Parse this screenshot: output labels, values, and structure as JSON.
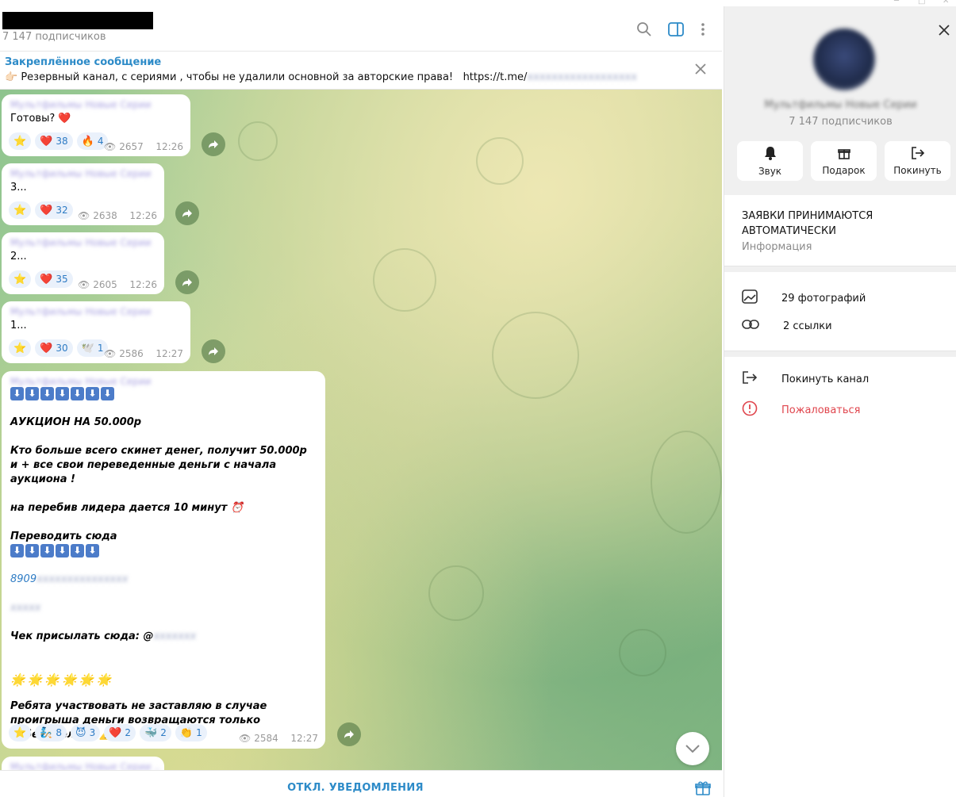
{
  "header": {
    "subscribers": "7 147 подписчиков"
  },
  "pinned": {
    "title": "Закреплённое сообщение",
    "emoji": "👉🏻",
    "text": "Резервный канал, с сериями , чтобы не удалили основной за авторские права!",
    "link": "https://t.me/"
  },
  "messages": [
    {
      "text": "Готовы? ❤️",
      "reactions": [
        {
          "emoji": "⭐",
          "count": ""
        },
        {
          "emoji": "❤️",
          "count": "38"
        },
        {
          "emoji": "🔥",
          "count": "4"
        }
      ],
      "views": "2657",
      "time": "12:26"
    },
    {
      "text": "3...",
      "reactions": [
        {
          "emoji": "⭐",
          "count": ""
        },
        {
          "emoji": "❤️",
          "count": "32"
        }
      ],
      "views": "2638",
      "time": "12:26"
    },
    {
      "text": "2...",
      "reactions": [
        {
          "emoji": "⭐",
          "count": ""
        },
        {
          "emoji": "❤️",
          "count": "35"
        }
      ],
      "views": "2605",
      "time": "12:26"
    },
    {
      "text": "1...",
      "reactions": [
        {
          "emoji": "⭐",
          "count": ""
        },
        {
          "emoji": "❤️",
          "count": "30"
        },
        {
          "emoji": "🕊️",
          "count": "1"
        }
      ],
      "views": "2586",
      "time": "12:27"
    }
  ],
  "auction": {
    "line1": "АУКЦИОН НА 50.000р",
    "line2": "Кто больше всего скинет денег, получит 50.000р и + все свои переведенные деньги с начала аукциона !",
    "line3": "на перебив лидера дается 10 минут ⏰",
    "line4": "Переводить сюда",
    "phone_prefix": "8909",
    "check_label": "Чек присылать сюда: @",
    "line5": "Ребята участвовать не заставляю в случае проигрыша деньги возвращаются только победителю ⚡ ⚠️",
    "reactions": [
      {
        "emoji": "⭐",
        "count": ""
      },
      {
        "emoji": "🧞",
        "count": "8"
      },
      {
        "emoji": "😈",
        "count": "3"
      },
      {
        "emoji": "❤️",
        "count": "2"
      },
      {
        "emoji": "🐳",
        "count": "2"
      },
      {
        "emoji": "👏",
        "count": "1"
      }
    ],
    "views": "2584",
    "time": "12:27"
  },
  "bottom": {
    "mute_label": "ОТКЛ. УВЕДОМЛЕНИЯ"
  },
  "panel": {
    "subscribers": "7 147 подписчиков",
    "buttons": [
      {
        "label": "Звук",
        "icon": "bell-icon"
      },
      {
        "label": "Подарок",
        "icon": "gift-icon"
      },
      {
        "label": "Покинуть",
        "icon": "leave-icon"
      }
    ],
    "description": "ЗАЯВКИ ПРИНИМАЮТСЯ АВТОМАТИЧЕСКИ",
    "description_label": "Информация",
    "photos": "29 фотографий",
    "links": "2 ссылки",
    "leave": "Покинуть канал",
    "report": "Пожаловаться"
  },
  "colors": {
    "accent": "#2d8bc8",
    "danger": "#e0454d",
    "chat_bg": "#a9cc96"
  }
}
